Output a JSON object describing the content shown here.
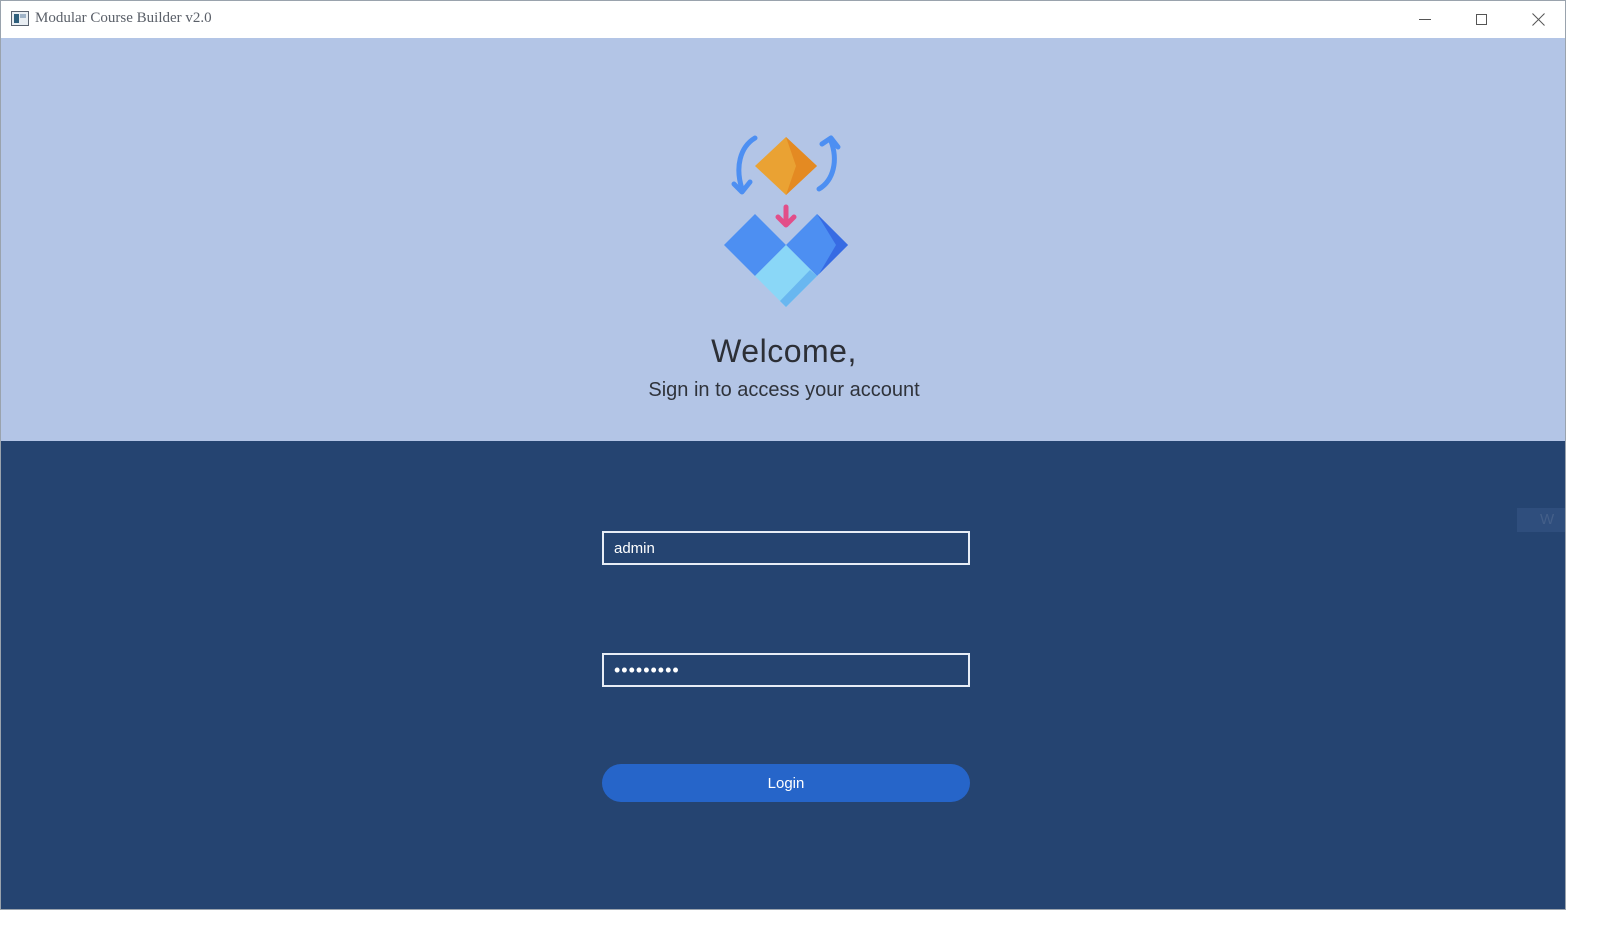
{
  "window": {
    "title": "Modular Course Builder v2.0",
    "controls": {
      "minimize_icon": "minimize-icon",
      "maximize_icon": "maximize-icon",
      "close_icon": "close-icon"
    }
  },
  "hero": {
    "logo_icon": "modular-blocks-icon",
    "welcome": "Welcome,",
    "subtitle": "Sign in to access your account",
    "background_color": "#b3c5e6"
  },
  "login": {
    "username_value": "admin",
    "password_value": "•••••••••",
    "login_button": "Login",
    "panel_color": "#254471",
    "button_color": "#2665c9"
  },
  "side_tab": {
    "label": "W"
  }
}
